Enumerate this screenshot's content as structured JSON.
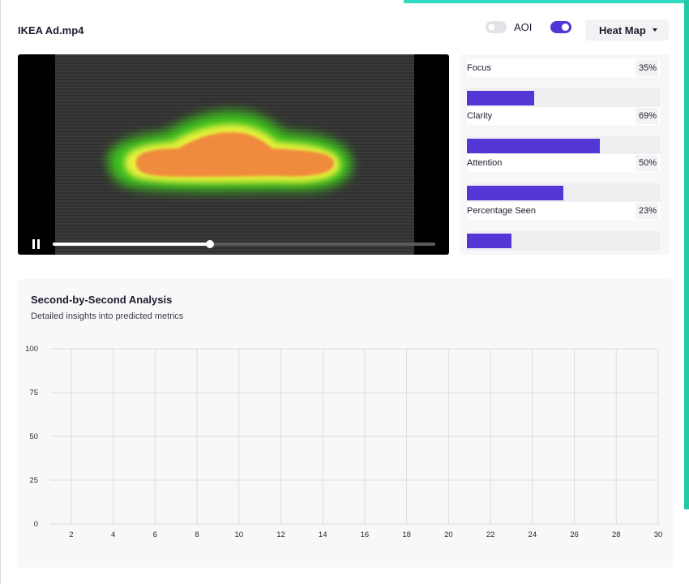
{
  "header": {
    "title": "IKEA Ad.mp4",
    "aoi_toggle": {
      "label": "AOI",
      "state": "off"
    },
    "heatmap_toggle": {
      "state": "on"
    },
    "view_select": {
      "selected": "Heat Map",
      "icon": "chevron-down-icon"
    }
  },
  "video": {
    "overlay": "heat-map",
    "playback_state": "playing",
    "pause_icon": "pause-icon",
    "progress_fraction": 0.41
  },
  "metrics": [
    {
      "name": "Focus",
      "value": "35%",
      "fraction": 0.35
    },
    {
      "name": "Clarity",
      "value": "69%",
      "fraction": 0.69
    },
    {
      "name": "Attention",
      "value": "50%",
      "fraction": 0.5
    },
    {
      "name": "Percentage Seen",
      "value": "23%",
      "fraction": 0.23
    }
  ],
  "analysis": {
    "title": "Second-by-Second Analysis",
    "subtitle": "Detailed insights into predicted metrics"
  },
  "colors": {
    "accent": "#5436d6",
    "top_accent": "#2fdcbf",
    "heat_outer": "#4cd41c",
    "heat_ring": "#e8f03a",
    "heat_core": "#f08a3c"
  },
  "chart_data": {
    "type": "line",
    "title": "",
    "xlabel": "",
    "ylabel": "",
    "x_ticks": [
      "2",
      "4",
      "6",
      "8",
      "10",
      "12",
      "14",
      "16",
      "18",
      "20",
      "22",
      "24",
      "26",
      "28",
      "30"
    ],
    "y_ticks": [
      "0",
      "25",
      "50",
      "75",
      "100"
    ],
    "xlim": [
      1,
      30
    ],
    "ylim": [
      0,
      100
    ],
    "grid": true,
    "series": []
  }
}
